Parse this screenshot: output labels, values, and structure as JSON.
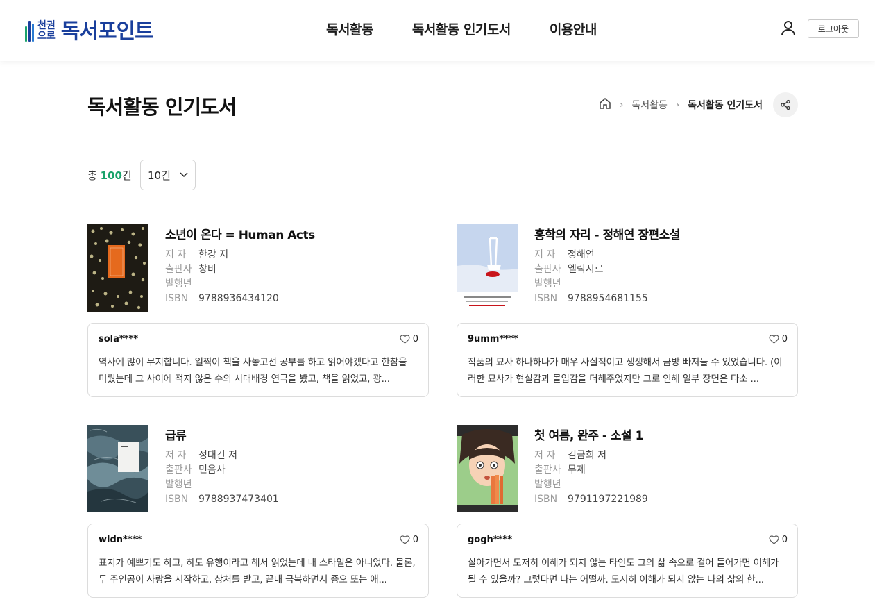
{
  "header": {
    "logo_small_1": "천권",
    "logo_small_2": "으로",
    "logo_text": "독서포인트",
    "nav": [
      "독서활동",
      "독서활동 인기도서",
      "이용안내"
    ],
    "logout_label": "로그아웃"
  },
  "page": {
    "title": "독서활동 인기도서",
    "breadcrumb": [
      "독서활동",
      "독서활동 인기도서"
    ]
  },
  "list": {
    "total_prefix": "총 ",
    "total_count": "100",
    "total_suffix": "건",
    "page_size": "10건"
  },
  "labels": {
    "author": "저 자",
    "publisher": "출판사",
    "year": "발행년",
    "isbn": "ISBN"
  },
  "books": [
    {
      "title": "소년이 온다 = Human Acts",
      "author": "한강 저",
      "publisher": "창비",
      "year": "",
      "isbn": "9788936434120",
      "review_user": "sola****",
      "likes": "0",
      "review": "역사에 많이 무지합니다. 일찍이 책을 사놓고선 공부를 하고 읽어야겠다고 한참을 미뤘는데 그 사이에 적지 않은 수의 시대배경 연극을 봤고, 책을 읽었고, 광..."
    },
    {
      "title": "홍학의 자리 - 정해연 장편소설",
      "author": "정해연",
      "publisher": "엘릭시르",
      "year": "",
      "isbn": "9788954681155",
      "review_user": "9umm****",
      "likes": "0",
      "review": "작품의 묘사 하나하나가 매우 사실적이고 생생해서 금방 빠져들 수 있었습니다. (이러한 묘사가 현실감과 몰입감을 더해주었지만 그로 인해 일부 장면은 다소 ..."
    },
    {
      "title": "급류",
      "author": "정대건 저",
      "publisher": "민음사",
      "year": "",
      "isbn": "9788937473401",
      "review_user": "wldn****",
      "likes": "0",
      "review": "표지가 예쁘기도 하고, 하도 유행이라고 해서 읽었는데 내 스타일은 아니었다. 물론, 두 주인공이 사랑을 시작하고, 상처를 받고, 끝내 극복하면서 증오 또는 애..."
    },
    {
      "title": "첫 여름, 완주 - 소설 1",
      "author": "김금희 저",
      "publisher": "무제",
      "year": "",
      "isbn": "9791197221989",
      "review_user": "gogh****",
      "likes": "0",
      "review": "살아가면서 도저히 이해가 되지 않는 타인도 그의 삶 속으로 걸어 들어가면 이해가 될 수 있을까? 그렇다면 나는 어떨까. 도저히 이해가 되지 않는 나의 삶의 한..."
    }
  ],
  "colors": {
    "brand": "#1a3f9c",
    "count_accent": "#1aa36b"
  },
  "icons": [
    "home-icon",
    "chevron-right-icon",
    "share-icon",
    "user-icon",
    "heart-icon",
    "chevron-down-icon"
  ]
}
